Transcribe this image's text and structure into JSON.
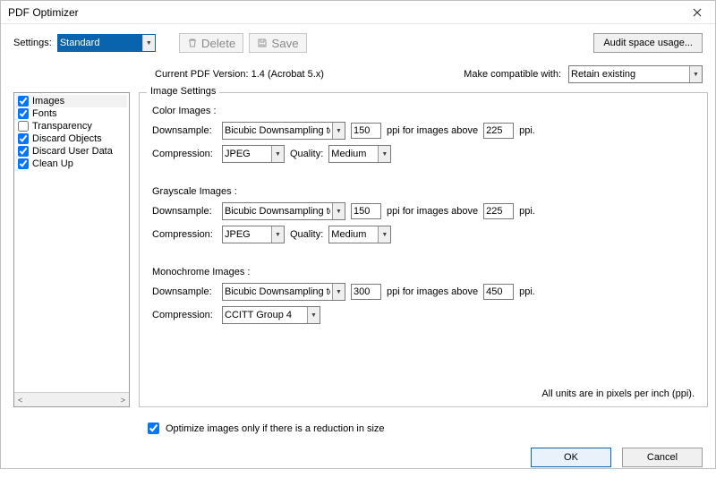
{
  "window": {
    "title": "PDF Optimizer"
  },
  "toolbar": {
    "settings_label": "Settings:",
    "settings_value": "Standard",
    "delete_label": "Delete",
    "save_label": "Save",
    "audit_label": "Audit space usage..."
  },
  "compat": {
    "current_label": "Current PDF Version: 1.4 (Acrobat 5.x)",
    "make_compat_label": "Make compatible with:",
    "make_compat_value": "Retain existing"
  },
  "sidebar": {
    "items": [
      {
        "label": "Images",
        "checked": true,
        "selected": true
      },
      {
        "label": "Fonts",
        "checked": true,
        "selected": false
      },
      {
        "label": "Transparency",
        "checked": false,
        "selected": false
      },
      {
        "label": "Discard Objects",
        "checked": true,
        "selected": false
      },
      {
        "label": "Discard User Data",
        "checked": true,
        "selected": false
      },
      {
        "label": "Clean Up",
        "checked": true,
        "selected": false
      }
    ]
  },
  "panel": {
    "legend": "Image Settings",
    "labels": {
      "downsample": "Downsample:",
      "compression": "Compression:",
      "quality": "Quality:",
      "ppi_above": "ppi for images above",
      "ppi": "ppi."
    },
    "color": {
      "title": "Color Images :",
      "downsample_method": "Bicubic Downsampling to",
      "downsample_value": "150",
      "above_value": "225",
      "compression": "JPEG",
      "quality": "Medium"
    },
    "grayscale": {
      "title": "Grayscale Images :",
      "downsample_method": "Bicubic Downsampling to",
      "downsample_value": "150",
      "above_value": "225",
      "compression": "JPEG",
      "quality": "Medium"
    },
    "mono": {
      "title": "Monochrome Images :",
      "downsample_method": "Bicubic Downsampling to",
      "downsample_value": "300",
      "above_value": "450",
      "compression": "CCITT Group 4"
    },
    "footnote": "All units are in pixels per inch (ppi)."
  },
  "optimize_checkbox": {
    "label": "Optimize images only if there is a reduction in size",
    "checked": true
  },
  "footer": {
    "ok": "OK",
    "cancel": "Cancel"
  }
}
